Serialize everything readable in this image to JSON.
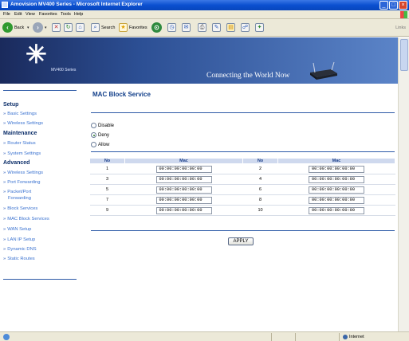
{
  "window": {
    "title": "Amovision MV400 Series - Microsoft Internet Explorer"
  },
  "menu": [
    "File",
    "Edit",
    "View",
    "Favorites",
    "Tools",
    "Help"
  ],
  "toolbar": {
    "back": "Back",
    "search": "Search",
    "favorites": "Favorites",
    "links": "Links"
  },
  "banner": {
    "series": "MV400 Series",
    "tagline": "Connecting the World Now"
  },
  "sidebar": {
    "setup": "Setup",
    "setup_items": [
      "Basic Settings",
      "Wireless Settings"
    ],
    "maintenance": "Maintenance",
    "maintenance_items": [
      "Router Status",
      "System Settings"
    ],
    "advanced": "Advanced",
    "advanced_items": [
      "Wireless Settings",
      "Port Forwarding",
      "Packet/Port",
      "Forwarding",
      "Block Services",
      "MAC Block Services",
      "WAN Setup",
      "LAN IP Setup",
      "Dynamic DNS",
      "Static Routes"
    ]
  },
  "page": {
    "title": "MAC Block Service",
    "options": [
      "Disable",
      "Deny",
      "Allow"
    ],
    "selected": "Deny",
    "columns": [
      "No",
      "Mac",
      "No",
      "Mac"
    ],
    "rows": [
      {
        "left_no": "1",
        "left_mac": "00:00:00:00:00:00",
        "right_no": "2",
        "right_mac": "00:00:00:00:00:00"
      },
      {
        "left_no": "3",
        "left_mac": "00:00:00:00:00:00",
        "right_no": "4",
        "right_mac": "00:00:00:00:00:00"
      },
      {
        "left_no": "5",
        "left_mac": "00:00:00:00:00:00",
        "right_no": "6",
        "right_mac": "00:00:00:00:00:00"
      },
      {
        "left_no": "7",
        "left_mac": "00:00:00:00:00:00",
        "right_no": "8",
        "right_mac": "00:00:00:00:00:00"
      },
      {
        "left_no": "9",
        "left_mac": "00:00:00:00:00:00",
        "right_no": "10",
        "right_mac": "00:00:00:00:00:00"
      }
    ],
    "apply_label": "APPLY"
  },
  "status": {
    "zone": "Internet"
  },
  "colors": {
    "heading": "#123f8a",
    "link": "#3a72d0",
    "rule": "#2d5aa7",
    "table_header": "#cfd9ee"
  }
}
